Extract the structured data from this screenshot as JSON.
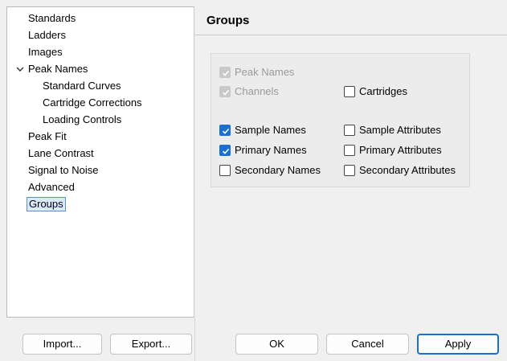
{
  "sidebar": {
    "items": [
      {
        "label": "Standards"
      },
      {
        "label": "Ladders"
      },
      {
        "label": "Images"
      },
      {
        "label": "Peak Names",
        "expanded": true
      },
      {
        "label": "Standard Curves"
      },
      {
        "label": "Cartridge Corrections"
      },
      {
        "label": "Loading Controls"
      },
      {
        "label": "Peak Fit"
      },
      {
        "label": "Lane Contrast"
      },
      {
        "label": "Signal to Noise"
      },
      {
        "label": "Advanced"
      },
      {
        "label": "Groups",
        "selected": true
      }
    ]
  },
  "content": {
    "title": "Groups",
    "checkboxes": {
      "peak_names": {
        "label": "Peak Names",
        "checked": true,
        "disabled": true
      },
      "channels": {
        "label": "Channels",
        "checked": true,
        "disabled": true
      },
      "cartridges": {
        "label": "Cartridges",
        "checked": false
      },
      "sample_names": {
        "label": "Sample Names",
        "checked": true
      },
      "sample_attributes": {
        "label": "Sample Attributes",
        "checked": false
      },
      "primary_names": {
        "label": "Primary Names",
        "checked": true
      },
      "primary_attributes": {
        "label": "Primary Attributes",
        "checked": false
      },
      "secondary_names": {
        "label": "Secondary Names",
        "checked": false
      },
      "secondary_attributes": {
        "label": "Secondary Attributes",
        "checked": false
      }
    }
  },
  "buttons": {
    "import": "Import...",
    "export": "Export...",
    "ok": "OK",
    "cancel": "Cancel",
    "apply": "Apply"
  },
  "colors": {
    "accent": "#1c6fd0",
    "selection_bg": "#dbeafb"
  }
}
